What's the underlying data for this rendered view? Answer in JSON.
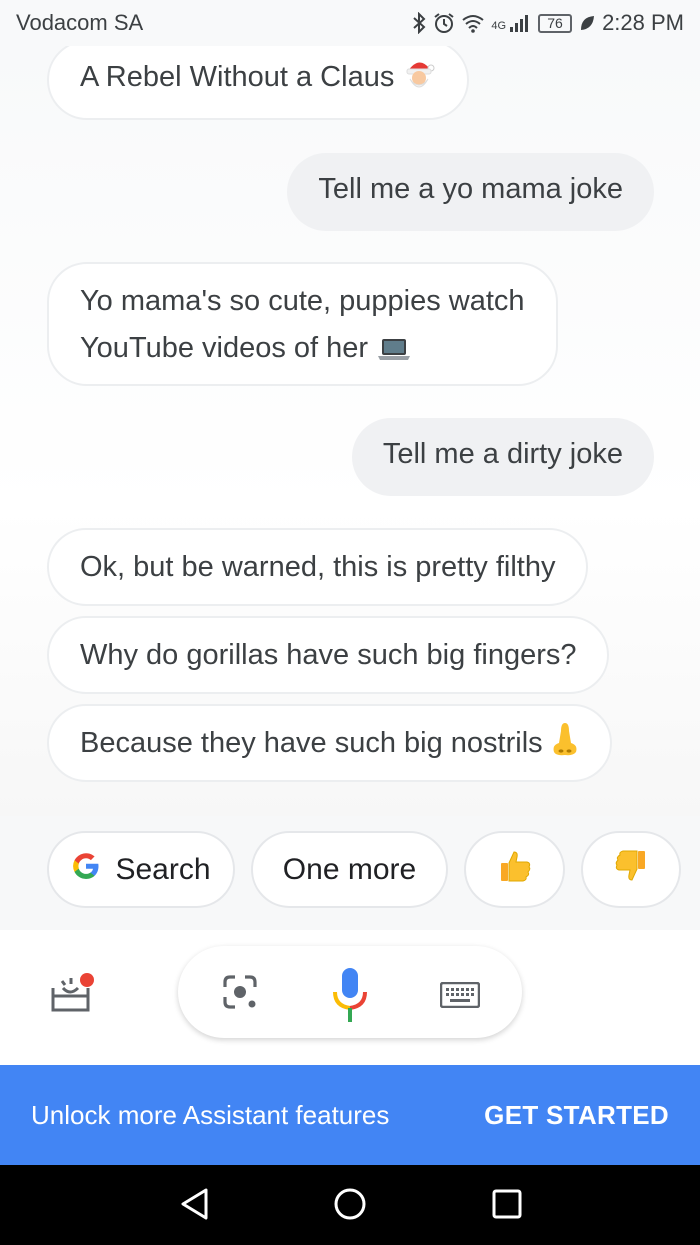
{
  "status_bar": {
    "carrier": "Vodacom SA",
    "network": "4G",
    "battery": "76",
    "time": "2:28 PM"
  },
  "conversation": [
    {
      "sender": "assistant",
      "text": "A Rebel Without a Claus",
      "emoji": "santa-icon"
    },
    {
      "sender": "user",
      "text": "Tell me a yo mama joke"
    },
    {
      "sender": "assistant",
      "line1": "Yo mama's so cute, puppies watch",
      "line2": "YouTube videos of her",
      "emoji": "laptop-icon"
    },
    {
      "sender": "user",
      "text": "Tell me a dirty joke"
    },
    {
      "sender": "assistant",
      "text": "Ok, but be warned, this is pretty filthy"
    },
    {
      "sender": "assistant",
      "text": "Why do gorillas have such big fingers?"
    },
    {
      "sender": "assistant",
      "text": "Because they have such big nostrils",
      "emoji": "nose-icon"
    }
  ],
  "suggestions": [
    {
      "label": "Search",
      "icon": "google-g-icon"
    },
    {
      "label": "One more"
    },
    {
      "icon": "thumbs-up-icon"
    },
    {
      "icon": "thumbs-down-icon"
    }
  ],
  "input_bar": {
    "left_icon": "explore-icon",
    "icons": [
      "lens-icon",
      "microphone-icon",
      "keyboard-icon"
    ]
  },
  "banner": {
    "text": "Unlock more Assistant features",
    "cta": "GET STARTED"
  },
  "colors": {
    "banner": "#4285f4",
    "google_blue": "#4285f4",
    "google_red": "#ea4335",
    "google_yellow": "#fbbc05",
    "google_green": "#34a853",
    "emoji_yellow": "#fbc02d"
  },
  "nav_bar": [
    "back-icon",
    "home-icon",
    "recents-icon"
  ]
}
